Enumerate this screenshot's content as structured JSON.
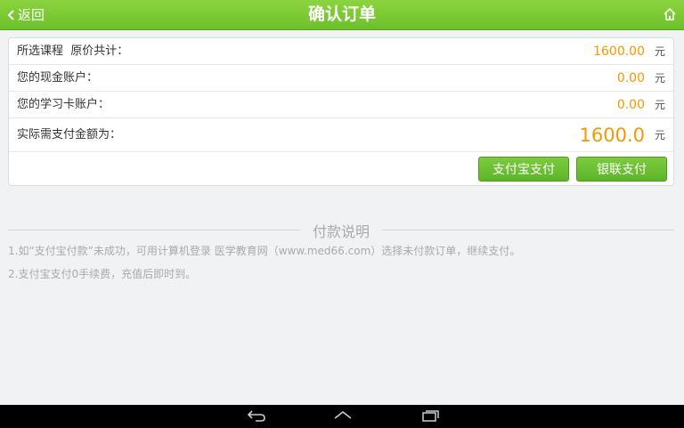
{
  "header": {
    "back_label": "返回",
    "title": "确认订单",
    "home_icon": "home-icon"
  },
  "order": {
    "rows": [
      {
        "label": "所选课程  原价共计：",
        "value": "1600.00",
        "unit": "元"
      },
      {
        "label": "您的现金账户：",
        "value": "0.00",
        "unit": "元"
      },
      {
        "label": "您的学习卡账户：",
        "value": "0.00",
        "unit": "元"
      },
      {
        "label": "实际需支付金额为：",
        "value": "1600.0",
        "unit": "元"
      }
    ],
    "alipay_button": "支付宝支付",
    "unionpay_button": "银联支付"
  },
  "payment_notes": {
    "title": "付款说明",
    "notes": [
      "1.如“支付宝付款”未成功，可用计算机登录 医学教育网（www.med66.com）选择未付款订单，继续支付。",
      "2.支付宝支付0手续费，充值后即时到。"
    ]
  },
  "colors": {
    "header_green": "#78c832",
    "amount_orange": "#f39800",
    "button_green": "#6cc02a"
  },
  "nav_icons": [
    "back-nav-icon",
    "home-nav-icon",
    "recent-apps-icon"
  ]
}
